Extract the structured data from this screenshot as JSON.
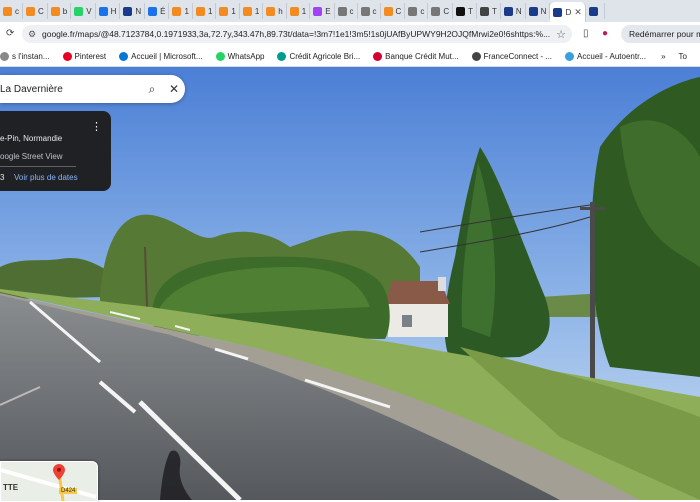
{
  "tabs": [
    {
      "label": "c",
      "color": "#f28b21"
    },
    {
      "label": "C",
      "color": "#f28b21"
    },
    {
      "label": "b",
      "color": "#f28b21"
    },
    {
      "label": "V",
      "color": "#25d366"
    },
    {
      "label": "H",
      "color": "#1a73e8"
    },
    {
      "label": "N",
      "color": "#1a3a8a"
    },
    {
      "label": "É",
      "color": "#1a73e8"
    },
    {
      "label": "1",
      "color": "#f28b21"
    },
    {
      "label": "1",
      "color": "#f28b21"
    },
    {
      "label": "1",
      "color": "#f28b21"
    },
    {
      "label": "1",
      "color": "#f28b21"
    },
    {
      "label": "h",
      "color": "#f28b21"
    },
    {
      "label": "1",
      "color": "#f28b21"
    },
    {
      "label": "E",
      "color": "#a142f4"
    },
    {
      "label": "c",
      "color": "#777777"
    },
    {
      "label": "c",
      "color": "#777777"
    },
    {
      "label": "C",
      "color": "#f28b21"
    },
    {
      "label": "c",
      "color": "#777777"
    },
    {
      "label": "C",
      "color": "#777777"
    },
    {
      "label": "T",
      "color": "#111111"
    },
    {
      "label": "T",
      "color": "#444444"
    },
    {
      "label": "N",
      "color": "#1a3a8a"
    },
    {
      "label": "N",
      "color": "#1a3a8a"
    },
    {
      "label": "D",
      "color": "#1a3a8a",
      "active": true
    },
    {
      "label": "",
      "color": "#1a3a8a"
    }
  ],
  "address": {
    "url": "google.fr/maps/@48.7123784,0.1971933,3a,72.7y,343.47h,89.73t/data=!3m7!1e1!3m5!1s0jUAfByUPWY9H2OJQfMrwi2e0!6shttps:%..."
  },
  "toolbar": {
    "restart_label": "Redémarrer pour met"
  },
  "bookmarks": [
    {
      "label": "s l'instan...",
      "color": "#888888"
    },
    {
      "label": "Pinterest",
      "color": "#e60023"
    },
    {
      "label": "Accueil | Microsoft...",
      "color": "#0078d4"
    },
    {
      "label": "WhatsApp",
      "color": "#25d366"
    },
    {
      "label": "Crédit Agricole Bri...",
      "color": "#009c8d"
    },
    {
      "label": "Banque Crédit Mut...",
      "color": "#d50032"
    },
    {
      "label": "FranceConnect - ...",
      "color": "#444444"
    },
    {
      "label": "Accueil - Autoentr...",
      "color": "#39a0db"
    }
  ],
  "bookmarks_overflow": "To",
  "search": {
    "query": "La Davernière"
  },
  "infocard": {
    "location": "e-Pin, Normandie",
    "source": "oogle Street View",
    "date": "3",
    "more_dates": "Voir plus de dates"
  },
  "minimap": {
    "label": "TTE",
    "road": "D424"
  },
  "colors": {
    "sky_top": "#4b7fd6",
    "sky_bottom": "#cfe0f2",
    "road": "#6b6e72",
    "grass": "#8fae5a",
    "hedge": "#3d6b2a",
    "info_bg": "#202124",
    "link": "#8ab4f8"
  }
}
